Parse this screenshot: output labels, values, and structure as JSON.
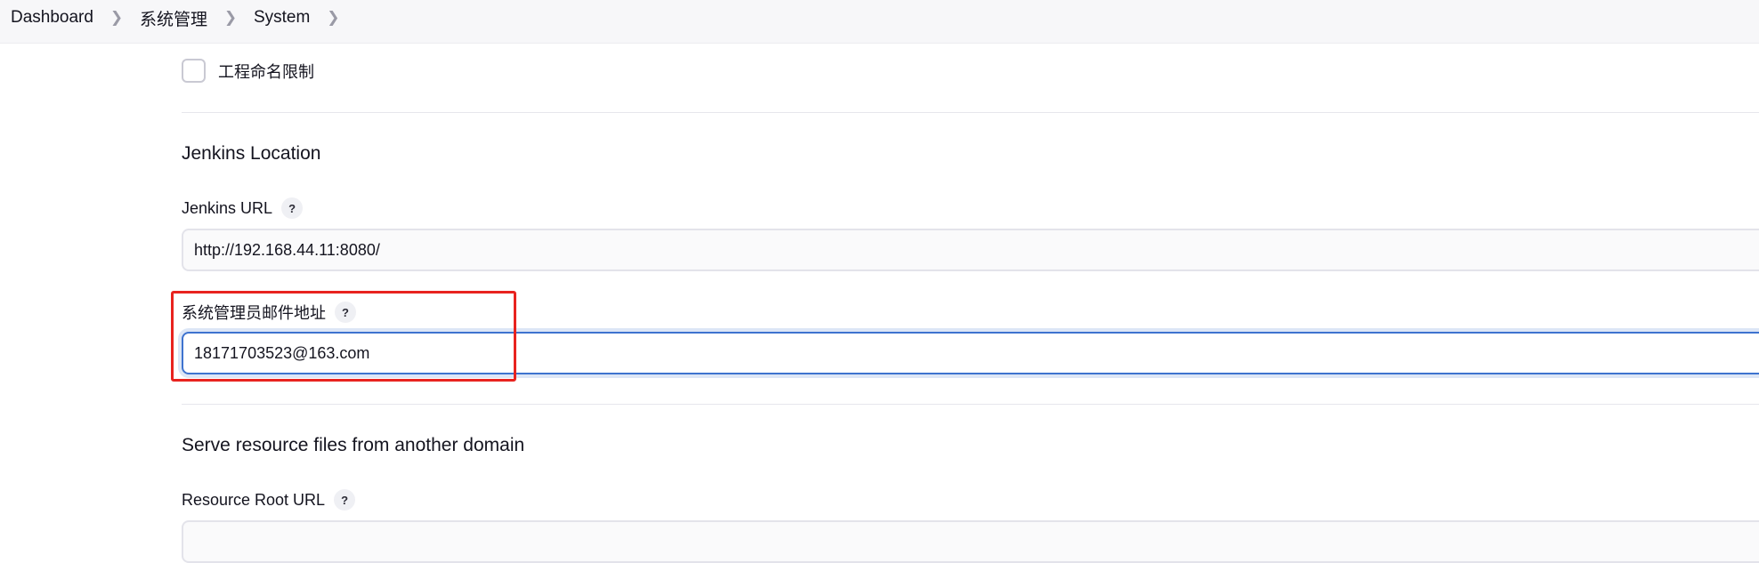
{
  "breadcrumb": {
    "items": [
      "Dashboard",
      "系统管理",
      "System"
    ]
  },
  "project_naming": {
    "label": "工程命名限制",
    "checked": false
  },
  "jenkins_location": {
    "title": "Jenkins Location",
    "url_label": "Jenkins URL",
    "url_value": "http://192.168.44.11:8080/",
    "admin_email_label": "系统管理员邮件地址",
    "admin_email_value": "18171703523@163.com"
  },
  "resource_domain": {
    "title": "Serve resource files from another domain",
    "root_url_label": "Resource Root URL",
    "root_url_value": ""
  },
  "help_icon_text": "?",
  "colors": {
    "highlight": "#e8231f",
    "focus": "#3e73cf"
  }
}
